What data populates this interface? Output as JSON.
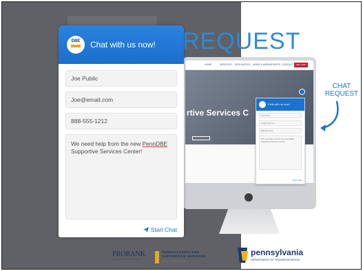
{
  "headline": "REQUEST",
  "chat_widget": {
    "title": "Chat with us now!",
    "logo_text": "DBE",
    "fields": {
      "name": "Joe Public",
      "email": "Joe@email.com",
      "phone": "888-555-1212"
    },
    "message_before": "We need help from the new ",
    "message_link": "PennDBE",
    "message_after": " Supportive Services Center!",
    "start_chat_label": "Start Chat",
    "accent_color": "#1b72cf"
  },
  "monitor_screen": {
    "hero_title": "rtive Services C",
    "mini_chat_title": "Chat with us now!",
    "mini_fields": [
      "Joe Public",
      "Joe@email.com",
      "888-555-1212"
    ],
    "mini_message": "We need help from the new PennDBE Supportive Services Center!",
    "mini_start": "Start Chat"
  },
  "chat_request_label": "CHAT REQUEST",
  "logos": {
    "prorank": "PRORANK",
    "prorank_sub": "BUSINESS SOLUTIONS",
    "ppdbe_line1": "PENNSYLVANIA DBE",
    "ppdbe_line2": "SUPPORTIVE SERVICES",
    "ppdbe_sub": "Business Solutions Center",
    "penn_name": "pennsylvania",
    "penn_dept": "DEPARTMENT OF TRANSPORTATION"
  }
}
